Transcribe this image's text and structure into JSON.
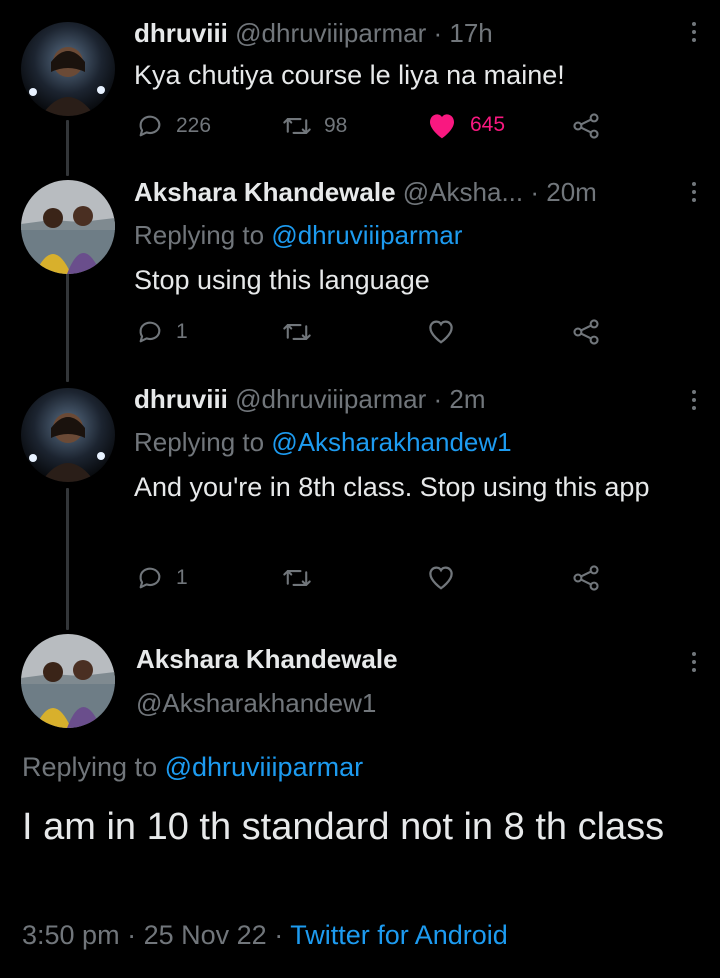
{
  "colors": {
    "accent": "#1d9bf0",
    "like": "#f91880",
    "muted": "#71767b",
    "text": "#e7e9ea",
    "background": "#000000"
  },
  "tweets": [
    {
      "display_name": "dhruviii",
      "handle": "@dhruviiiparmar",
      "time": "· 17h",
      "text": "Kya chutiya course le liya na maine!",
      "replies": "226",
      "retweets": "98",
      "likes": "645",
      "liked": true
    },
    {
      "display_name": "Akshara Khandewale",
      "handle": "@Aksha...",
      "time": "· 20m",
      "replying_prefix": "Replying to",
      "replying_handle": "@dhruviiiparmar",
      "text": "Stop using this language",
      "replies": "1"
    },
    {
      "display_name": "dhruviii",
      "handle": "@dhruviiiparmar",
      "time": "· 2m",
      "replying_prefix": "Replying to",
      "replying_handle": "@Aksharakhandew1",
      "text": "And you're in 8th class. Stop using this app",
      "replies": "1"
    }
  ],
  "main_tweet": {
    "display_name": "Akshara Khandewale",
    "handle": "@Aksharakhandew1",
    "replying_prefix": "Replying to",
    "replying_handle": "@dhruviiiparmar",
    "text": "I am in 10 th standard not in 8 th class",
    "time": "3:50 pm",
    "date": "25 Nov 22",
    "source": "Twitter for Android",
    "separator": "·"
  },
  "icons": [
    "reply-icon",
    "retweet-icon",
    "heart-icon",
    "share-icon",
    "more-icon"
  ]
}
